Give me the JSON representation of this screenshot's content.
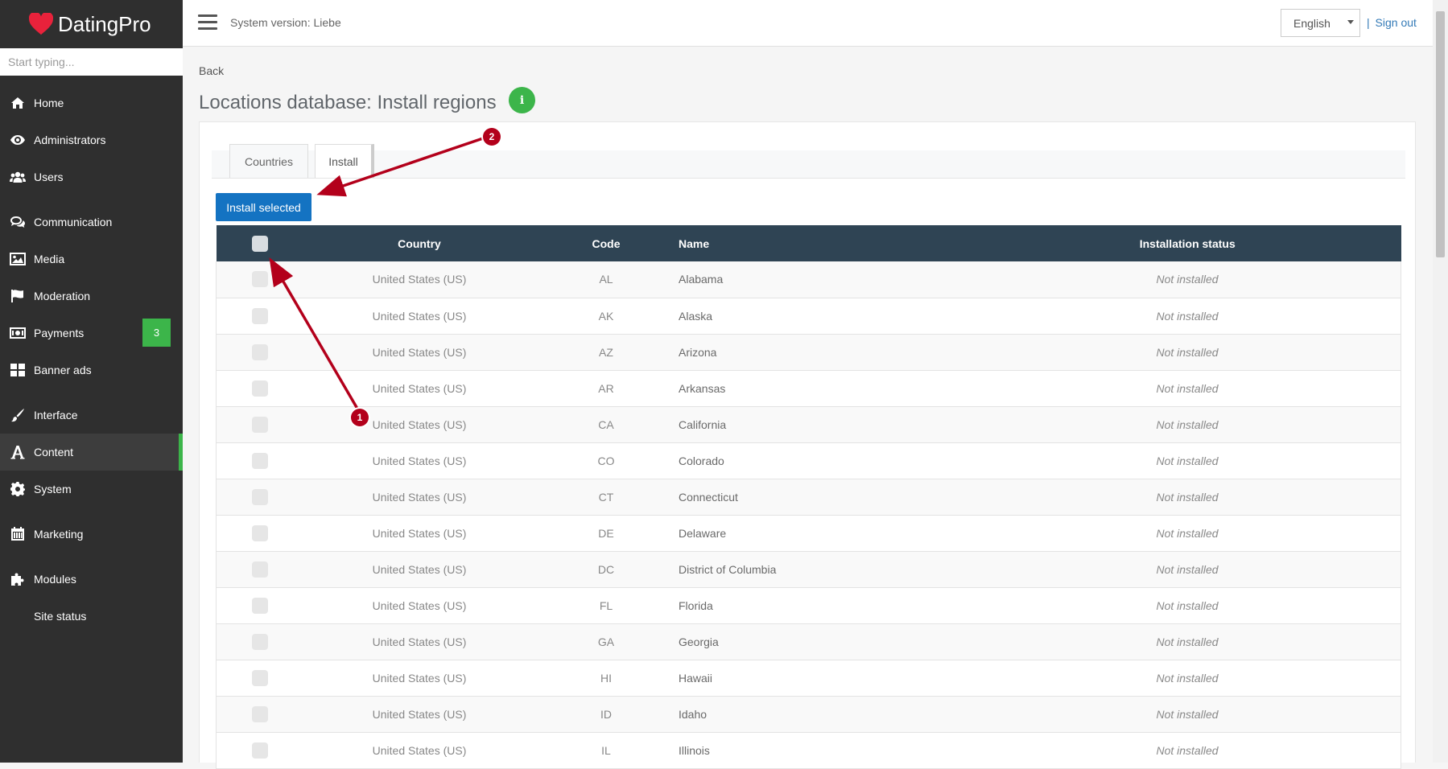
{
  "sidebar": {
    "logo_text": "DatingPro",
    "search_placeholder": "Start typing...",
    "items": [
      {
        "label": "Home",
        "icon": "home-icon"
      },
      {
        "label": "Administrators",
        "icon": "eye-icon"
      },
      {
        "label": "Users",
        "icon": "users-icon"
      },
      {
        "label": "Communication",
        "icon": "comments-icon"
      },
      {
        "label": "Media",
        "icon": "image-icon"
      },
      {
        "label": "Moderation",
        "icon": "flag-icon"
      },
      {
        "label": "Payments",
        "icon": "money-icon",
        "badge": "3"
      },
      {
        "label": "Banner ads",
        "icon": "grid-icon"
      },
      {
        "label": "Interface",
        "icon": "brush-icon"
      },
      {
        "label": "Content",
        "icon": "font-icon",
        "active": true
      },
      {
        "label": "System",
        "icon": "gear-icon"
      },
      {
        "label": "Marketing",
        "icon": "calendar-icon"
      },
      {
        "label": "Modules",
        "icon": "puzzle-icon"
      },
      {
        "label": "Site status",
        "icon": ""
      }
    ]
  },
  "header": {
    "system_version": "System version: Liebe",
    "language": "English",
    "sign_out": "Sign out",
    "separator": "|"
  },
  "main": {
    "back_label": "Back",
    "title": "Locations database: Install regions",
    "info_icon_text": "i",
    "tabs": [
      {
        "label": "Countries",
        "active": false
      },
      {
        "label": "Install",
        "active": true
      }
    ],
    "install_button": "Install selected",
    "table": {
      "columns": [
        "Country",
        "Code",
        "Name",
        "Installation status"
      ],
      "rows": [
        {
          "country": "United States (US)",
          "code": "AL",
          "name": "Alabama",
          "status": "Not installed"
        },
        {
          "country": "United States (US)",
          "code": "AK",
          "name": "Alaska",
          "status": "Not installed"
        },
        {
          "country": "United States (US)",
          "code": "AZ",
          "name": "Arizona",
          "status": "Not installed"
        },
        {
          "country": "United States (US)",
          "code": "AR",
          "name": "Arkansas",
          "status": "Not installed"
        },
        {
          "country": "United States (US)",
          "code": "CA",
          "name": "California",
          "status": "Not installed"
        },
        {
          "country": "United States (US)",
          "code": "CO",
          "name": "Colorado",
          "status": "Not installed"
        },
        {
          "country": "United States (US)",
          "code": "CT",
          "name": "Connecticut",
          "status": "Not installed"
        },
        {
          "country": "United States (US)",
          "code": "DE",
          "name": "Delaware",
          "status": "Not installed"
        },
        {
          "country": "United States (US)",
          "code": "DC",
          "name": "District of Columbia",
          "status": "Not installed"
        },
        {
          "country": "United States (US)",
          "code": "FL",
          "name": "Florida",
          "status": "Not installed"
        },
        {
          "country": "United States (US)",
          "code": "GA",
          "name": "Georgia",
          "status": "Not installed"
        },
        {
          "country": "United States (US)",
          "code": "HI",
          "name": "Hawaii",
          "status": "Not installed"
        },
        {
          "country": "United States (US)",
          "code": "ID",
          "name": "Idaho",
          "status": "Not installed"
        },
        {
          "country": "United States (US)",
          "code": "IL",
          "name": "Illinois",
          "status": "Not installed"
        }
      ]
    }
  },
  "annotations": {
    "marker_1": "1",
    "marker_2": "2"
  },
  "colors": {
    "sidebar_bg": "#2f2f2f",
    "accent_green": "#3cb54a",
    "primary_blue": "#1473c2",
    "table_header_bg": "#2f4454",
    "annotation_red": "#b3001b"
  }
}
